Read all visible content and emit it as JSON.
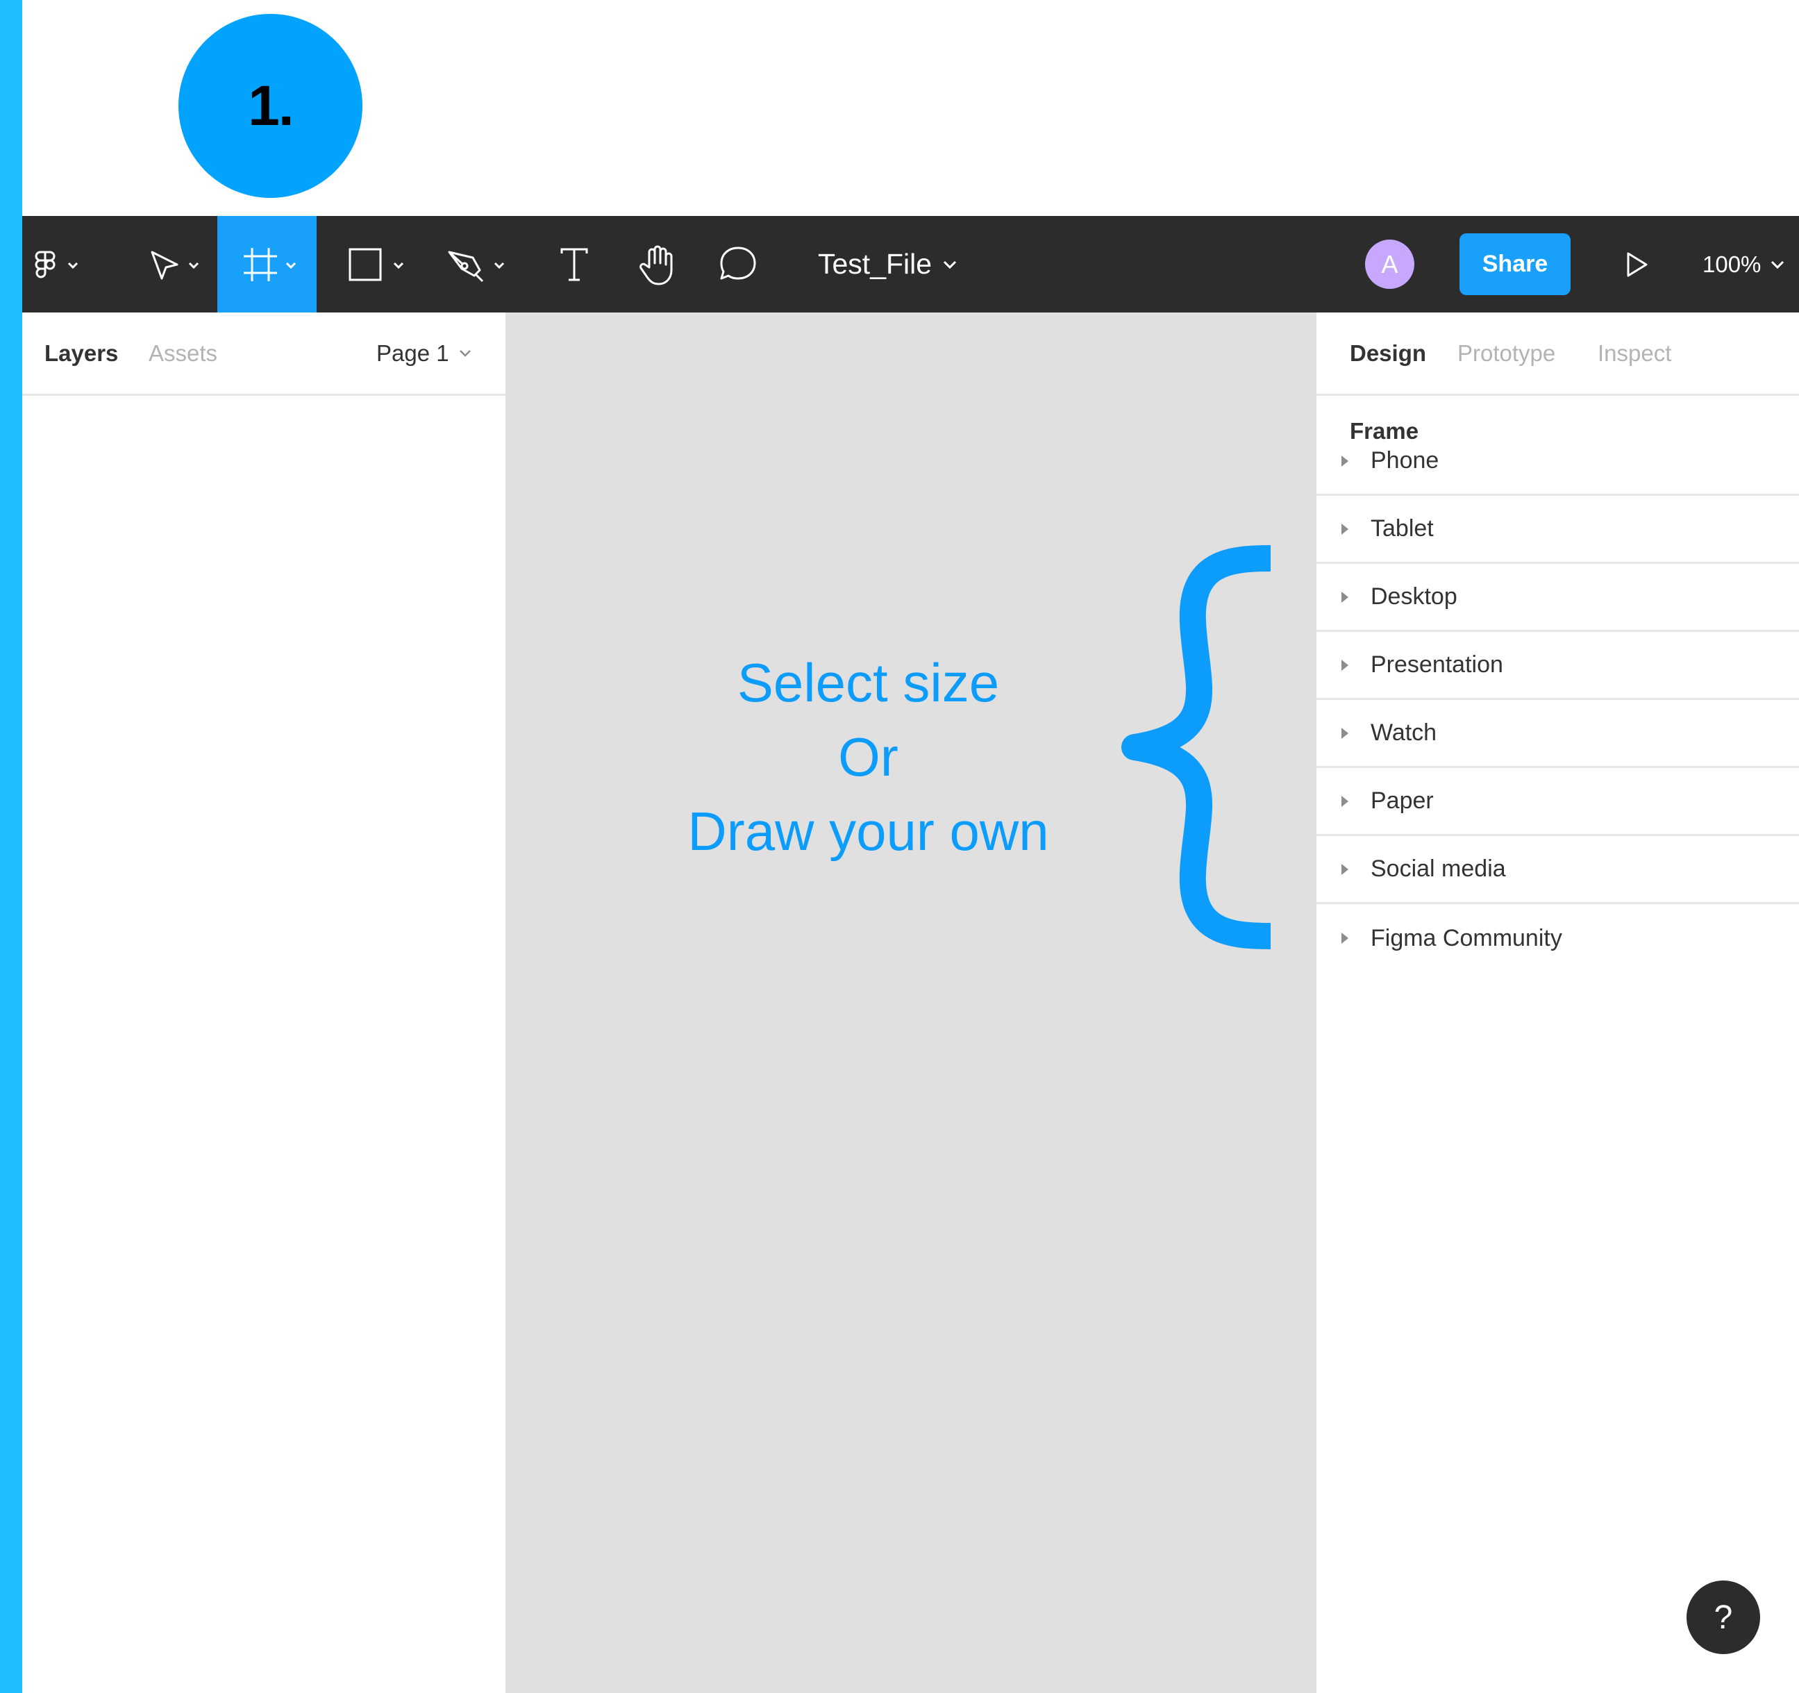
{
  "step_badge": "1.",
  "colors": {
    "accent": "#18a0fb",
    "badge": "#02a2ff",
    "stripe": "#1fbdff",
    "toolbar_bg": "#2c2c2c",
    "canvas_bg": "#e0e0e0",
    "annotation": "#0c9cfb",
    "avatar": "#c8a8ff"
  },
  "toolbar": {
    "tools": [
      {
        "icon": "figma-menu-icon",
        "has_dropdown": true
      },
      {
        "icon": "move-tool-icon",
        "has_dropdown": true
      },
      {
        "icon": "frame-tool-icon",
        "has_dropdown": true,
        "active": true
      },
      {
        "icon": "shape-tool-icon",
        "has_dropdown": true
      },
      {
        "icon": "pen-tool-icon",
        "has_dropdown": true
      },
      {
        "icon": "text-tool-icon",
        "has_dropdown": false
      },
      {
        "icon": "hand-tool-icon",
        "has_dropdown": false
      },
      {
        "icon": "comment-tool-icon",
        "has_dropdown": false
      }
    ],
    "file_name": "Test_File",
    "avatar_initial": "A",
    "share_label": "Share",
    "zoom_level": "100%"
  },
  "left_panel": {
    "tabs": [
      "Layers",
      "Assets"
    ],
    "active_tab": "Layers",
    "page": "Page 1"
  },
  "canvas": {
    "hint_lines": [
      "Select size",
      "Or",
      "Draw your own"
    ]
  },
  "right_panel": {
    "tabs": [
      "Design",
      "Prototype",
      "Inspect"
    ],
    "active_tab": "Design",
    "section_title": "Frame",
    "frame_presets": [
      "Phone",
      "Tablet",
      "Desktop",
      "Presentation",
      "Watch",
      "Paper",
      "Social media",
      "Figma Community"
    ]
  },
  "help_label": "?"
}
